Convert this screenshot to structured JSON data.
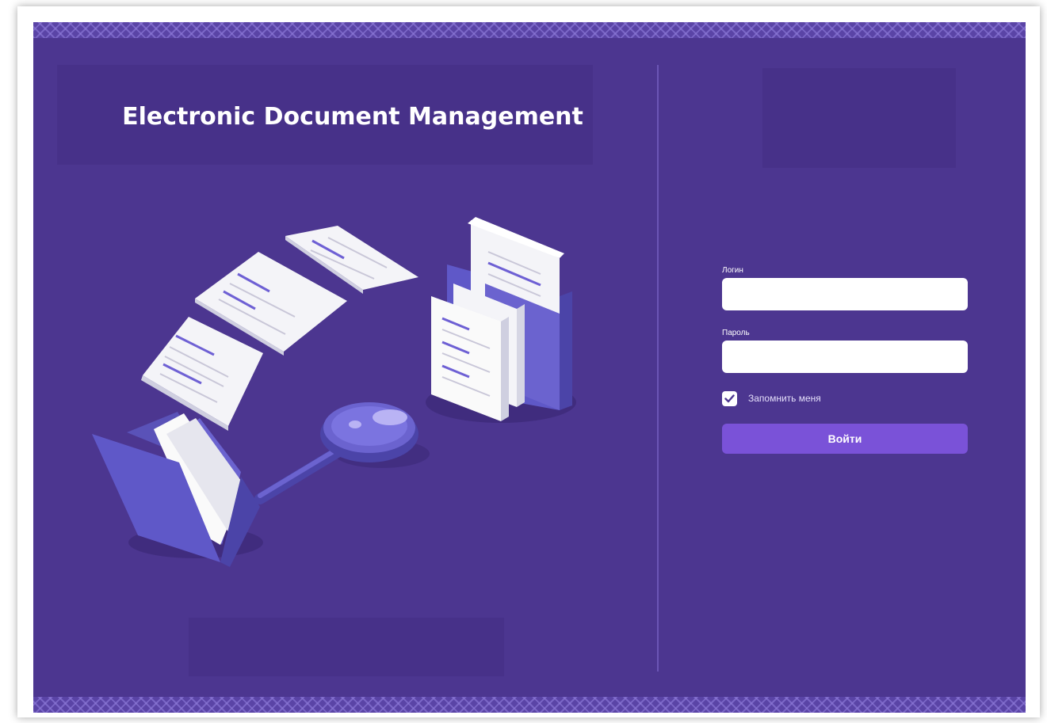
{
  "branding": {
    "title": "Electronic Document Management"
  },
  "illustration": {
    "icons": [
      "document-icon",
      "folder-icon",
      "magnifier-icon"
    ]
  },
  "login_form": {
    "login_label": "Логин",
    "login_value": "",
    "password_label": "Пароль",
    "password_value": "",
    "remember_label": "Запомнить меня",
    "remember_checked": true,
    "submit_label": "Войти"
  },
  "colors": {
    "background": "#4c3690",
    "accent_button": "#7a52d8",
    "divider": "#6b55b5",
    "redacted_block": "#473189"
  }
}
